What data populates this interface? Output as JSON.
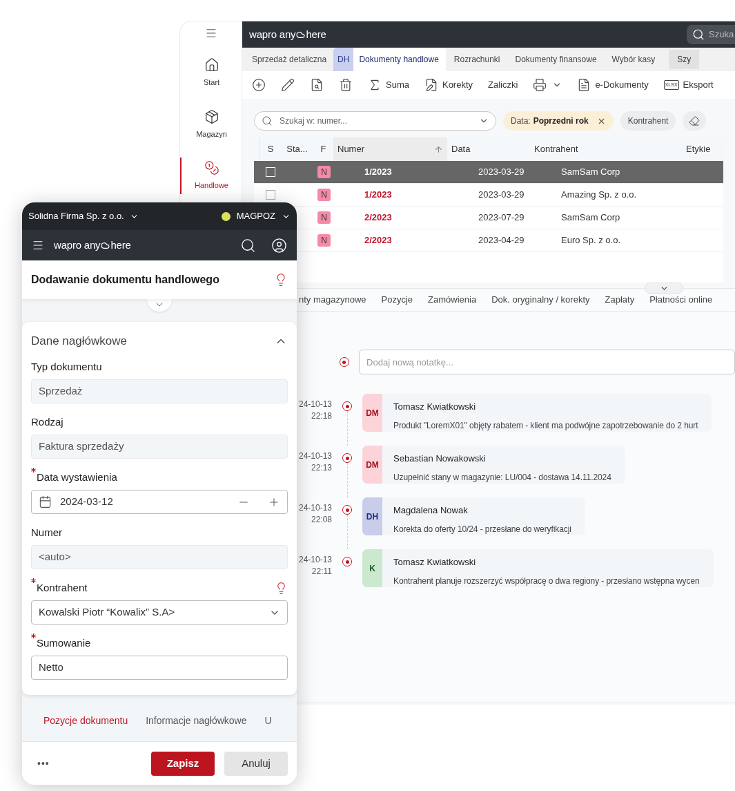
{
  "desktop": {
    "sidebar": {
      "items": [
        {
          "label": "Start",
          "kind": "home",
          "selected": false
        },
        {
          "label": "Magazyn",
          "kind": "warehouse",
          "selected": false
        },
        {
          "label": "Handlowe",
          "kind": "trade",
          "selected": true
        }
      ]
    },
    "logo": {
      "prefix": "wapro any",
      "suffix": "here"
    },
    "search": {
      "placeholder": "Szuka"
    },
    "tabs": [
      {
        "label": "Sprzedaż detaliczna",
        "selected": false
      },
      {
        "badge": "DH",
        "label": "Dokumenty handlowe",
        "selected": true
      },
      {
        "label": "Rozrachunki",
        "selected": false
      },
      {
        "label": "Dokumenty finansowe",
        "selected": false
      },
      {
        "label": "Wybór kasy",
        "selected": false
      },
      {
        "label": "Szy",
        "kind": "button",
        "selected": false
      }
    ],
    "toolbar": [
      {
        "kind": "add"
      },
      {
        "kind": "edit"
      },
      {
        "kind": "preview"
      },
      {
        "kind": "delete"
      },
      {
        "kind": "sum",
        "label": "Suma"
      },
      {
        "kind": "corrections",
        "label": "Korekty"
      },
      {
        "kind": "text",
        "label": "Zaliczki"
      },
      {
        "kind": "print"
      },
      {
        "kind": "edocs",
        "label": "e-Dokumenty"
      },
      {
        "kind": "export",
        "icon_text": "XLSX",
        "label": "Eksport"
      }
    ],
    "filter": {
      "placeholder": "Szukaj w: numer...",
      "chips": [
        {
          "kind": "value",
          "label": "Data:",
          "value": "Poprzedni rok"
        },
        {
          "kind": "plain",
          "label": "Kontrahent"
        }
      ]
    },
    "table": {
      "columns": [
        {
          "label": "S"
        },
        {
          "label": "Sta..."
        },
        {
          "label": "F"
        },
        {
          "label": "Numer",
          "sorted": true
        },
        {
          "label": "Data"
        },
        {
          "label": "Kontrahent"
        },
        {
          "label": "Etykie"
        }
      ],
      "rows": [
        {
          "selected": true,
          "checked": false,
          "status": "N",
          "number": "1/2023",
          "date": "2023-03-29",
          "contractor": "SamSam Corp"
        },
        {
          "selected": false,
          "checked": false,
          "status": "N",
          "number": "1/2023",
          "date": "2023-03-29",
          "contractor": "Amazing Sp. z o.o."
        },
        {
          "selected": false,
          "status": "N",
          "number": "2/2023",
          "date": "2023-07-29",
          "contractor": "SamSam Corp"
        },
        {
          "selected": false,
          "status": "N",
          "number": "2/2023",
          "date": "2023-04-29",
          "contractor": "Euro Sp. z o.o."
        }
      ]
    },
    "detail_tabs": [
      "nty magazynowe",
      "Pozycje",
      "Zamówienia",
      "Dok. oryginalny / korekty",
      "Zapłaty",
      "Płatności online"
    ],
    "notes": {
      "placeholder": "Dodaj nową notatkę...",
      "items": [
        {
          "date": "24-10-13",
          "time": "22:18",
          "badge": "DM",
          "color": "#fdd3da",
          "author": "Tomasz Kwiatkowski",
          "text": "Produkt \"LoremX01\" objęty rabatem - klient ma podwójne zapotrzebowanie do 2 hurt"
        },
        {
          "date": "24-10-13",
          "time": "22:13",
          "badge": "DM",
          "color": "#fdd3da",
          "author": "Sebastian Nowakowski",
          "text": "Uzupełnić stany w magazynie: LU/004 - dostawa 14.11.2024"
        },
        {
          "date": "24-10-13",
          "time": "22:08",
          "badge": "DH",
          "color": "#c8cdea",
          "author": "Magdalena Nowak",
          "text": "Korekta do oferty 10/24 - przesłane do weryfikacji"
        },
        {
          "date": "24-10-13",
          "time": "22:11",
          "badge": "K",
          "color": "#cbe9cf",
          "author": "Tomasz Kwiatkowski",
          "text": "Kontrahent planuje rozszerzyć współpracę o dwa regiony - przesłano wstępna wycen"
        }
      ]
    }
  },
  "mobile": {
    "company": "Solidna Firma Sp. z o.o.",
    "warehouse": "MAGPOZ",
    "logo": {
      "prefix": "wapro any",
      "suffix": "here"
    },
    "title": "Dodawanie dokumentu handlowego",
    "section": {
      "title": "Dane nagłówkowe",
      "expanded": true
    },
    "fields": [
      {
        "label": "Typ dokumentu",
        "kind": "readonly",
        "value": "Sprzedaż",
        "required": false,
        "hint": false
      },
      {
        "label": "Rodzaj",
        "kind": "readonly",
        "value": "Faktura sprzedaży",
        "required": false,
        "hint": false
      },
      {
        "label": "Data wystawienia",
        "kind": "date",
        "value": "2024-03-12",
        "required": true,
        "hint": false
      },
      {
        "label": "Numer",
        "kind": "readonly",
        "value": "<auto>",
        "required": false,
        "hint": false
      },
      {
        "label": "Kontrahent",
        "kind": "select",
        "value": "Kowalski Piotr “Kowalix” S.A>",
        "required": true,
        "hint": true
      },
      {
        "label": "Sumowanie",
        "kind": "input",
        "value": "Netto",
        "required": true,
        "hint": false
      }
    ],
    "bottom_tabs": [
      {
        "label": "Pozycje dokumentu",
        "selected": true
      },
      {
        "label": "Informacje nagłówkowe",
        "selected": false
      },
      {
        "label": "U",
        "selected": false
      }
    ],
    "actions": {
      "more": "•••",
      "save": "Zapisz",
      "cancel": "Anuluj"
    }
  }
}
